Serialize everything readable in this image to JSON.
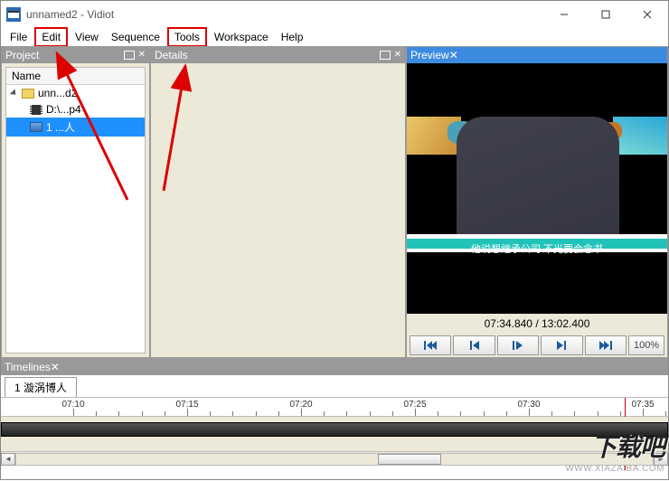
{
  "window": {
    "title": "unnamed2 - Vidiot"
  },
  "menu": {
    "file": "File",
    "edit": "Edit",
    "view": "View",
    "sequence": "Sequence",
    "tools": "Tools",
    "workspace": "Workspace",
    "help": "Help"
  },
  "panels": {
    "project": "Project",
    "details": "Details",
    "preview": "Preview",
    "timelines": "Timelines"
  },
  "project_tree": {
    "header": "Name",
    "root": "unn...d2",
    "items": [
      {
        "icon": "clip",
        "label": "D:\\...p4"
      },
      {
        "icon": "seq",
        "label": "1 ...人"
      }
    ]
  },
  "preview": {
    "subtitle": "他说想继承公司 不光要会念书",
    "current": "07:34.840",
    "total": "13:02.400",
    "zoom": "100%"
  },
  "timeline": {
    "tab": "1 漩涡博人",
    "ticks": [
      "07:10",
      "07:15",
      "07:20",
      "07:25",
      "07:30",
      "07:35"
    ]
  },
  "watermark": {
    "big": "下载吧",
    "url": "WWW.XIAZAIBA.COM"
  }
}
